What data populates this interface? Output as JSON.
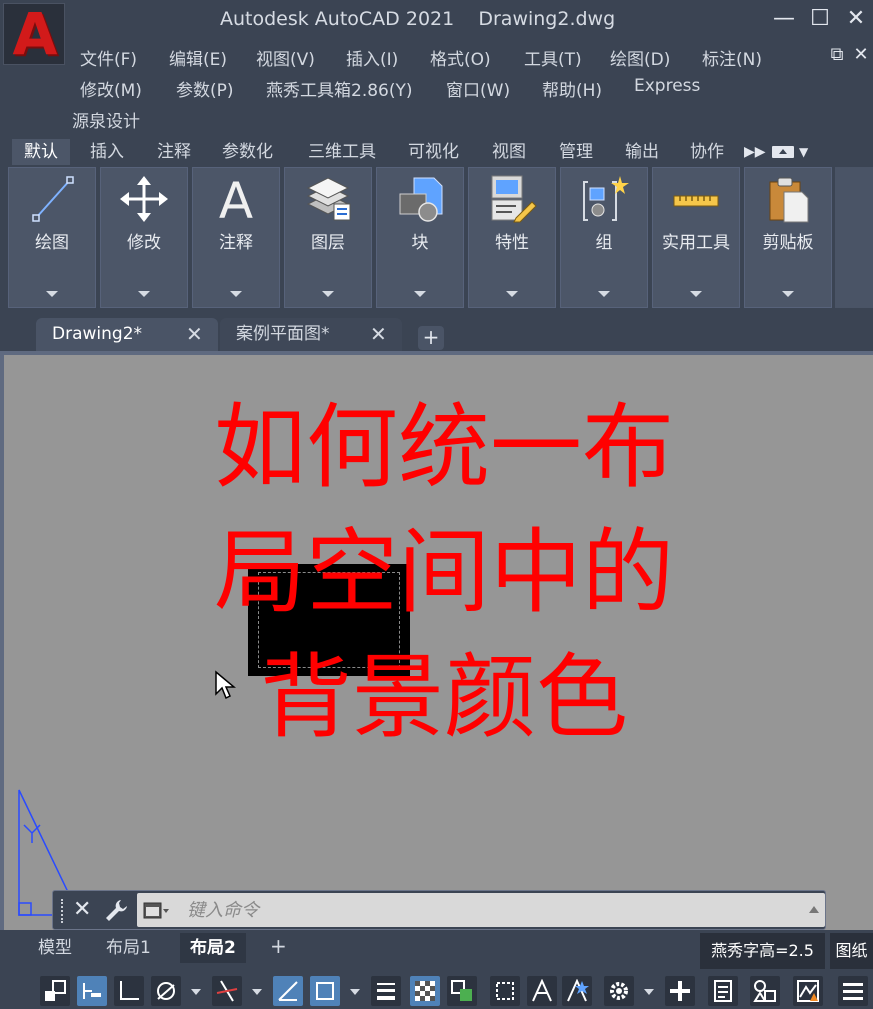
{
  "app": {
    "logo_letter": "A",
    "title": "Autodesk AutoCAD 2021    Drawing2.dwg"
  },
  "window_controls": {
    "minimize": "—",
    "maximize": "☐",
    "close": "✕",
    "restore": "⧉",
    "doc_close": "✕"
  },
  "menu": [
    "文件(F)",
    "编辑(E)",
    "视图(V)",
    "插入(I)",
    "格式(O)",
    "工具(T)",
    "绘图(D)",
    "标注(N)",
    "修改(M)",
    "参数(P)",
    "燕秀工具箱2.86(Y)",
    "窗口(W)",
    "帮助(H)",
    "Express",
    "源泉设计"
  ],
  "ribbon_tabs": [
    "默认",
    "插入",
    "注释",
    "参数化",
    "三维工具",
    "可视化",
    "视图",
    "管理",
    "输出",
    "协作"
  ],
  "ribbon_more": "▶▶",
  "ribbon_panels": [
    "绘图",
    "修改",
    "注释",
    "图层",
    "块",
    "特性",
    "组",
    "实用工具",
    "剪贴板"
  ],
  "doc_tabs": [
    {
      "label": "Drawing2*",
      "close": "✕"
    },
    {
      "label": "案例平面图*",
      "close": "✕"
    }
  ],
  "doc_tab_add": "+",
  "overlay_title": "如何统一布局空间中的背景颜色",
  "command_line": {
    "close": "✕",
    "placeholder": "键入命令"
  },
  "layout_tabs": [
    "模型",
    "布局1",
    "布局2"
  ],
  "layout_tab_add": "+",
  "status": {
    "text_height": "燕秀字高=2.5",
    "paper": "图纸"
  },
  "colors": {
    "accent_red": "#ff0000",
    "ribbon_bg": "#3b4453",
    "canvas_bg": "#969696",
    "ucs_blue": "#2a4bff",
    "active_toggle": "#4f82b8"
  }
}
